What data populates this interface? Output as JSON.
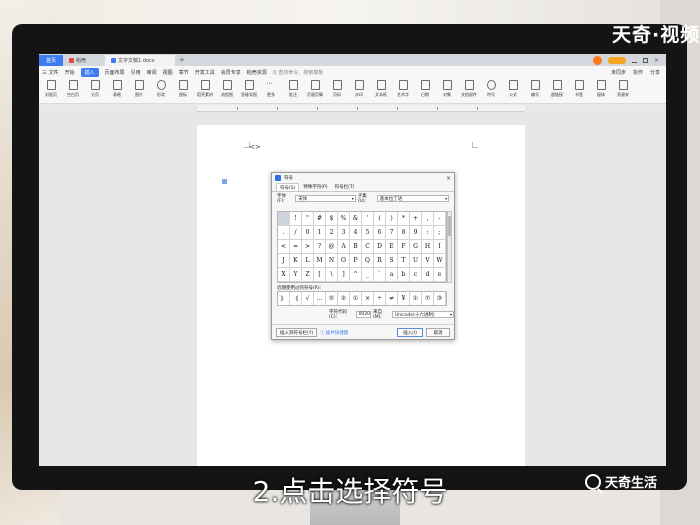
{
  "watermark": {
    "top": "天奇·视频",
    "bottom": "天奇生活"
  },
  "caption": "2.点击选择符号",
  "app": {
    "tabs": [
      {
        "label": "首页"
      },
      {
        "label": "稻壳"
      },
      {
        "label": "文字文稿1.docx"
      }
    ],
    "new_tab": "+",
    "menu": {
      "file": "三 文件",
      "items": [
        "开始",
        "插入",
        "页面布局",
        "引用",
        "审阅",
        "视图",
        "章节",
        "开发工具",
        "会员专享",
        "稻壳资源"
      ],
      "active": "插入",
      "search": "Q 查找命令、搜索模板",
      "right": [
        "未同步",
        "协作",
        "分享"
      ]
    },
    "ribbon": [
      "封面页",
      "空白页",
      "分页",
      "表格",
      "图片",
      "形状",
      "图标",
      "稻壳素材",
      "流程图",
      "思维导图",
      "更多",
      "批注",
      "页眉页脚",
      "页码",
      "水印",
      "文本框",
      "艺术字",
      "日期",
      "对象",
      "文档部件",
      "符号",
      "公式",
      "编号",
      "超链接",
      "书签",
      "窗体",
      "资源夹"
    ],
    "page_cursor_text": "<>"
  },
  "dialog": {
    "title": "符号",
    "close": "×",
    "tabs": [
      "符号(S)",
      "特殊字符(P)",
      "符号栏(T)"
    ],
    "active_tab": "符号(S)",
    "font_label": "字体(F):",
    "font_value": "宋体",
    "subset_label": "子集(U):",
    "subset_value": "基本拉丁语",
    "grid": [
      [
        " ",
        "!",
        "\"",
        "#",
        "$",
        "%",
        "&",
        "'",
        "(",
        ")",
        "*",
        "+",
        ",",
        "-"
      ],
      [
        ".",
        "/",
        "0",
        "1",
        "2",
        "3",
        "4",
        "5",
        "6",
        "7",
        "8",
        "9",
        ":",
        ";"
      ],
      [
        "<",
        "=",
        ">",
        "?",
        "@",
        "A",
        "B",
        "C",
        "D",
        "E",
        "F",
        "G",
        "H",
        "I"
      ],
      [
        "J",
        "K",
        "L",
        "M",
        "N",
        "O",
        "P",
        "Q",
        "R",
        "S",
        "T",
        "U",
        "V",
        "W"
      ],
      [
        "X",
        "Y",
        "Z",
        "[",
        "\\",
        "]",
        "^",
        "_",
        "`",
        "a",
        "b",
        "c",
        "d",
        "e"
      ]
    ],
    "recent_label": "近期使用过的符号(R):",
    "recent": [
      "》",
      "《",
      "√",
      "…",
      "⑤",
      "②",
      "①",
      "×",
      "÷",
      "≠",
      "¥",
      "①",
      "⑦",
      "③"
    ],
    "code_label": "字符代码(C):",
    "code_value": "0020",
    "from_label": "来自(M):",
    "from_value": "Unicode(十六进制)",
    "insert_to_bar": "插入到符号栏(Y)",
    "shortcut_link": "插件快捷键",
    "insert": "插入(I)",
    "cancel": "取消"
  }
}
